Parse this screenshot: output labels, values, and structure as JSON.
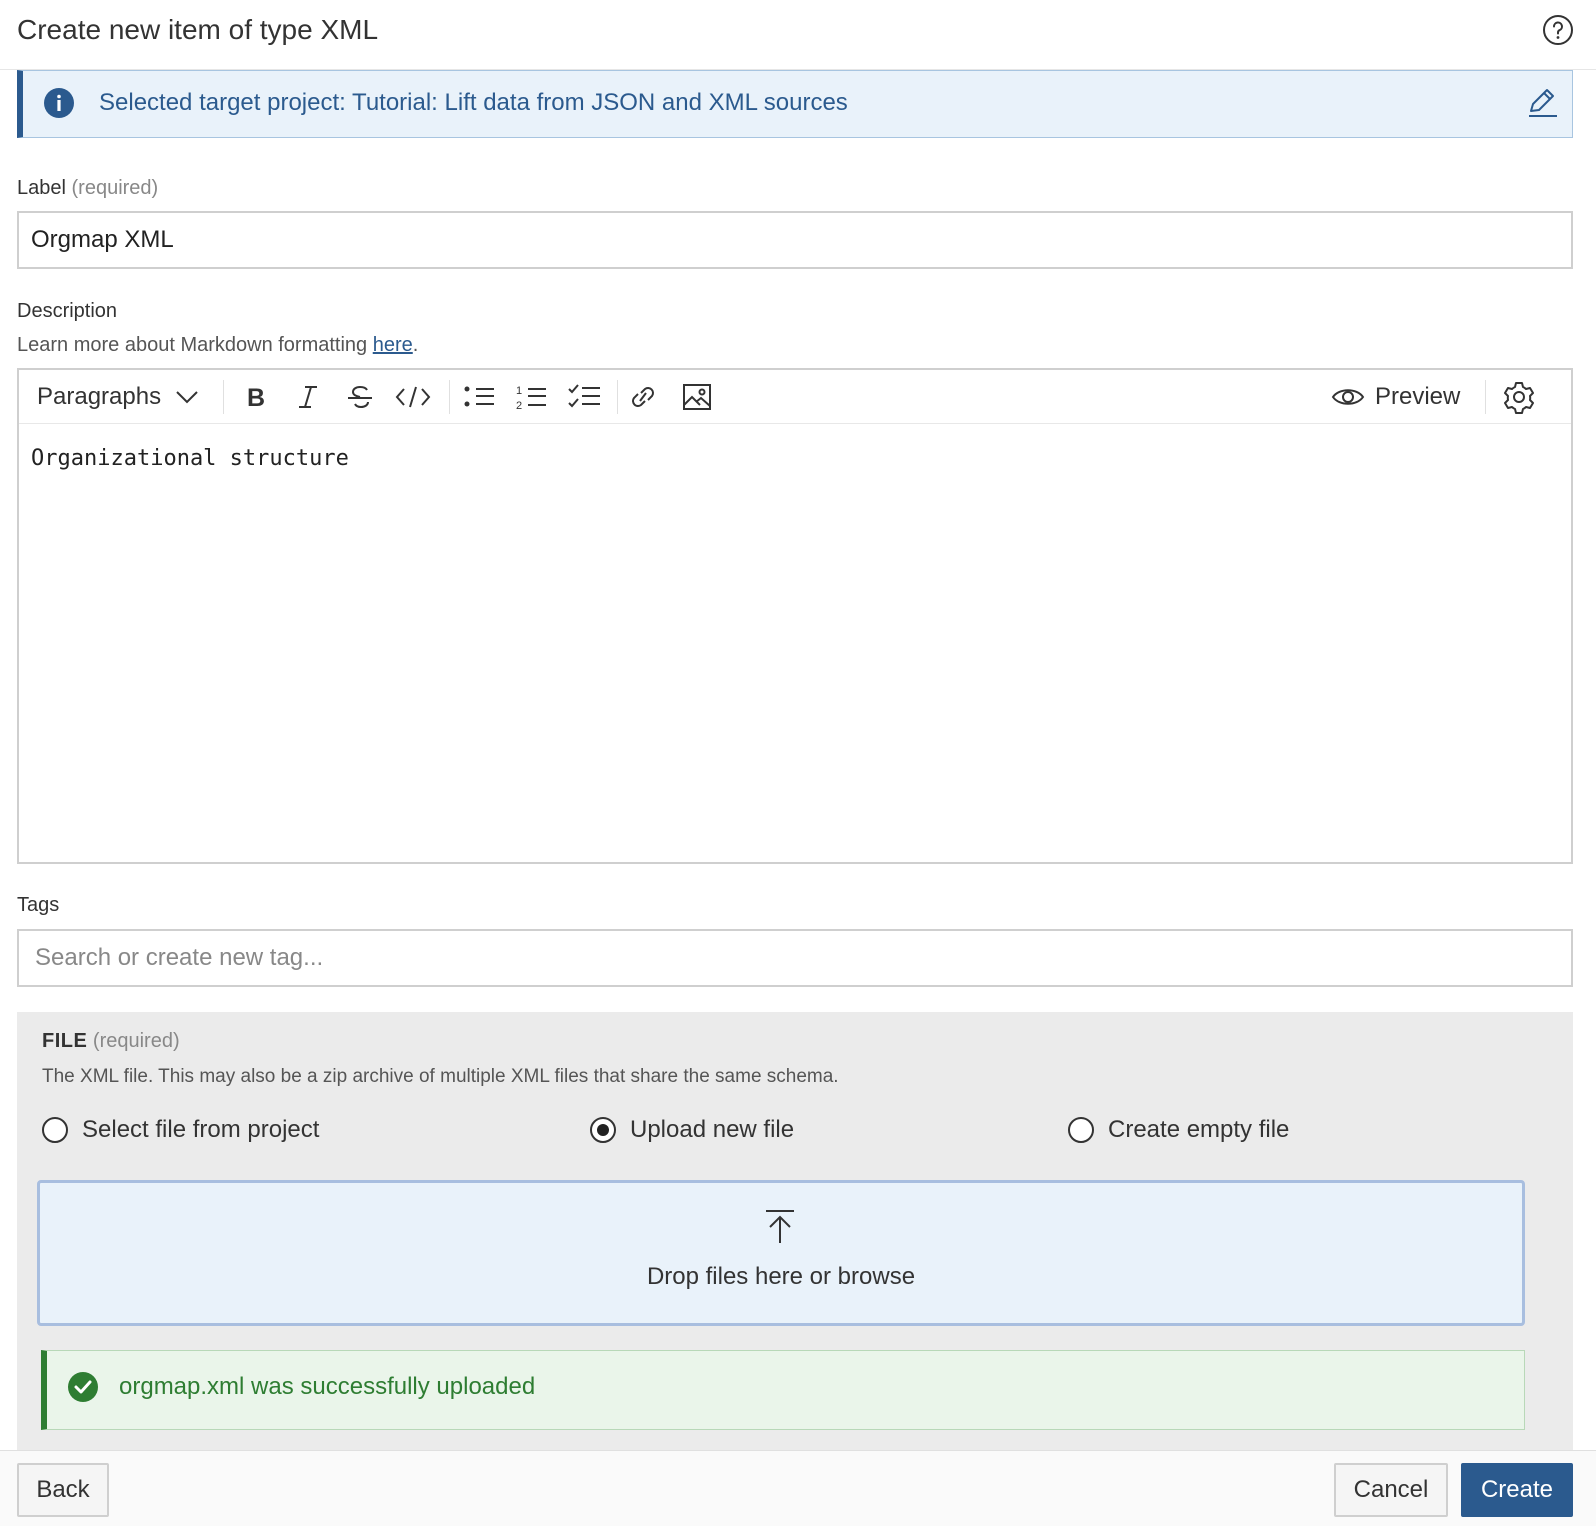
{
  "dialog": {
    "title": "Create new item of type XML",
    "help_icon": "help-circle-icon"
  },
  "banner": {
    "icon": "info-icon",
    "text": "Selected target project: Tutorial: Lift data from JSON and XML sources",
    "edit_icon": "edit-pencil-icon",
    "accent": "#2b5a8e"
  },
  "label_field": {
    "label": "Label",
    "required": "(required)",
    "value": "Orgmap XML"
  },
  "description": {
    "label": "Description",
    "hint_prefix": "Learn more about Markdown formatting ",
    "hint_link": "here",
    "hint_suffix": ".",
    "toolbar": {
      "paragraphs_label": "Paragraphs",
      "preview_label": "Preview"
    },
    "value": "Organizational structure"
  },
  "tags": {
    "label": "Tags",
    "placeholder": "Search or create new tag..."
  },
  "file": {
    "title": "FILE",
    "required": "(required)",
    "description": "The XML file. This may also be a zip archive of multiple XML files that share the same schema.",
    "options": [
      {
        "label": "Select file from project",
        "checked": false
      },
      {
        "label": "Upload new file",
        "checked": true
      },
      {
        "label": "Create empty file",
        "checked": false
      }
    ],
    "dropzone_text": "Drop files here or browse",
    "success_text": "orgmap.xml was successfully uploaded",
    "success_color": "#2e7d32"
  },
  "footer": {
    "back_label": "Back",
    "cancel_label": "Cancel",
    "create_label": "Create",
    "primary_color": "#2b5a8e"
  }
}
